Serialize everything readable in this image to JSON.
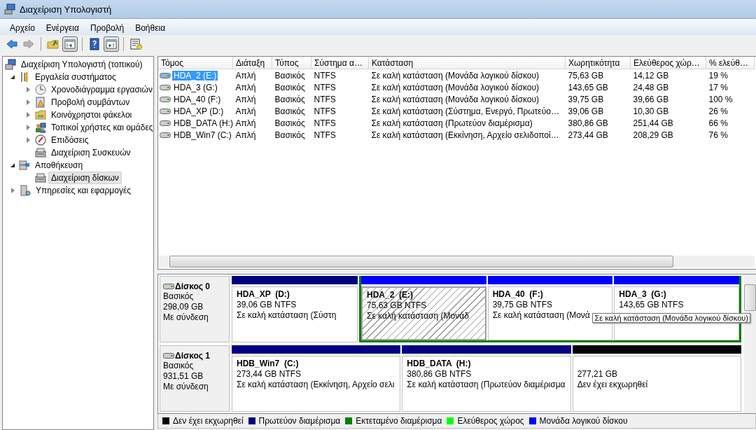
{
  "window": {
    "title": "Διαχείριση Υπολογιστή"
  },
  "menu": [
    "Αρχείο",
    "Ενέργεια",
    "Προβολή",
    "Βοήθεια"
  ],
  "toolbar": [
    {
      "kind": "back",
      "disabled": false,
      "pressed": false
    },
    {
      "kind": "forward",
      "disabled": true,
      "pressed": false
    },
    {
      "kind": "separator"
    },
    {
      "kind": "up",
      "disabled": false,
      "pressed": false
    },
    {
      "kind": "tree",
      "disabled": false,
      "pressed": true
    },
    {
      "kind": "separator"
    },
    {
      "kind": "help",
      "disabled": false,
      "pressed": false
    },
    {
      "kind": "action-pane",
      "disabled": false,
      "pressed": true
    },
    {
      "kind": "separator"
    },
    {
      "kind": "properties",
      "disabled": false,
      "pressed": false
    }
  ],
  "tree": {
    "root": {
      "label": "Διαχείριση Υπολογιστή (τοπικού)",
      "selected": false
    },
    "items": [
      {
        "label": "Εργαλεία συστήματος",
        "expanded": true,
        "selected": false,
        "children": [
          {
            "label": "Χρονοδιάγραμμα εργασιών",
            "expanded": false,
            "selected": false
          },
          {
            "label": "Προβολή συμβάντων",
            "expanded": false,
            "selected": false
          },
          {
            "label": "Κοινόχρηστοι φάκελοι",
            "expanded": false,
            "selected": false
          },
          {
            "label": "Τοπικοί χρήστες και ομάδες",
            "expanded": false,
            "selected": false
          },
          {
            "label": "Επιδόσεις",
            "expanded": false,
            "selected": false
          },
          {
            "label": "Διαχείριση Συσκευών",
            "selected": false
          }
        ]
      },
      {
        "label": "Αποθήκευση",
        "expanded": true,
        "selected": false,
        "children": [
          {
            "label": "Διαχείριση δίσκων",
            "selected": true
          }
        ]
      },
      {
        "label": "Υπηρεσίες και εφαρμογές",
        "expanded": false,
        "selected": false
      }
    ]
  },
  "volumes": {
    "columns": [
      "Τόμος",
      "Διάταξη",
      "Τύπος",
      "Σύστημα α…",
      "Κατάσταση",
      "Χωρητικότητα",
      "Ελεύθερος χώρ…",
      "% ελεύθ…"
    ],
    "rows": [
      {
        "selected": true,
        "cells": [
          "HDA_2 (E:)",
          "Απλή",
          "Βασικός",
          "NTFS",
          "Σε καλή κατάσταση (Μονάδα λογικού δίσκου)",
          "75,63 GB",
          "14,12 GB",
          "19 %"
        ]
      },
      {
        "selected": false,
        "cells": [
          "HDA_3 (G:)",
          "Απλή",
          "Βασικός",
          "NTFS",
          "Σε καλή κατάσταση (Μονάδα λογικού δίσκου)",
          "143,65 GB",
          "24,48 GB",
          "17 %"
        ]
      },
      {
        "selected": false,
        "cells": [
          "HDA_40 (F:)",
          "Απλή",
          "Βασικός",
          "NTFS",
          "Σε καλή κατάσταση (Μονάδα λογικού δίσκου)",
          "39,75 GB",
          "39,66 GB",
          "100 %"
        ]
      },
      {
        "selected": false,
        "cells": [
          "HDA_XP (D:)",
          "Απλή",
          "Βασικός",
          "NTFS",
          "Σε καλή κατάσταση (Σύστημα, Ενεργό, Πρωτεύο…",
          "39,06 GB",
          "10,30 GB",
          "26 %"
        ]
      },
      {
        "selected": false,
        "cells": [
          "HDB_DATA (H:)",
          "Απλή",
          "Βασικός",
          "NTFS",
          "Σε καλή κατάσταση (Πρωτεύον διαμέρισμα)",
          "380,86 GB",
          "251,44 GB",
          "66 %"
        ]
      },
      {
        "selected": false,
        "cells": [
          "HDB_Win7 (C:)",
          "Απλή",
          "Βασικός",
          "NTFS",
          "Σε καλή κατάσταση (Εκκίνηση, Αρχείο σελιδοποί…",
          "273,44 GB",
          "208,29 GB",
          "76 %"
        ]
      }
    ]
  },
  "disks": [
    {
      "title": "Δίσκος 0",
      "type": "Βασικός",
      "size": "298,09 GB",
      "state": "Με σύνδεση",
      "partitions": [
        {
          "kind": "primary",
          "selected": false,
          "name": "HDA_XP  (D:)",
          "size": "39,06 GB NTFS",
          "status": "Σε καλή κατάσταση (Σύστη"
        },
        {
          "kind": "extended",
          "children": [
            {
              "kind": "logical",
              "selected": true,
              "name": "HDA_2  (E:)",
              "size": "75,63 GB NTFS",
              "status": "Σε καλή κατάσταση (Μονάδ"
            },
            {
              "kind": "logical",
              "selected": false,
              "name": "HDA_40  (F:)",
              "size": "39,75 GB NTFS",
              "status": "Σε καλή κατάσταση (Μονά"
            },
            {
              "kind": "logical",
              "selected": false,
              "name": "HDA_3  (G:)",
              "size": "143,65 GB NTFS",
              "tooltip": "Σε καλή κατάσταση (Μονάδα λογικού δίσκου)"
            }
          ]
        }
      ]
    },
    {
      "title": "Δίσκος 1",
      "type": "Βασικός",
      "size": "931,51 GB",
      "state": "Με σύνδεση",
      "partitions": [
        {
          "kind": "primary",
          "selected": false,
          "name": "HDB_Win7  (C:)",
          "size": "273,44 GB NTFS",
          "status": "Σε καλή κατάσταση (Εκκίνηση, Αρχείο σελι"
        },
        {
          "kind": "primary",
          "selected": false,
          "name": "HDB_DATA  (H:)",
          "size": "380,86 GB NTFS",
          "status": "Σε καλή κατάσταση (Πρωτεύον διαμέρισμα"
        },
        {
          "kind": "unallocated",
          "selected": false,
          "size": "277,21 GB",
          "status": "Δεν έχει εκχωρηθεί"
        }
      ]
    }
  ],
  "legend": [
    {
      "label": "Δεν έχει εκχωρηθεί",
      "color": "#000000"
    },
    {
      "label": "Πρωτεύον διαμέρισμα",
      "color": "#000080"
    },
    {
      "label": "Εκτεταμένο διαμέρισμα",
      "color": "#008000"
    },
    {
      "label": "Ελεύθερος χώρος",
      "color": "#00ff00"
    },
    {
      "label": "Μονάδα λογικού δίσκου",
      "color": "#0000ff"
    }
  ]
}
